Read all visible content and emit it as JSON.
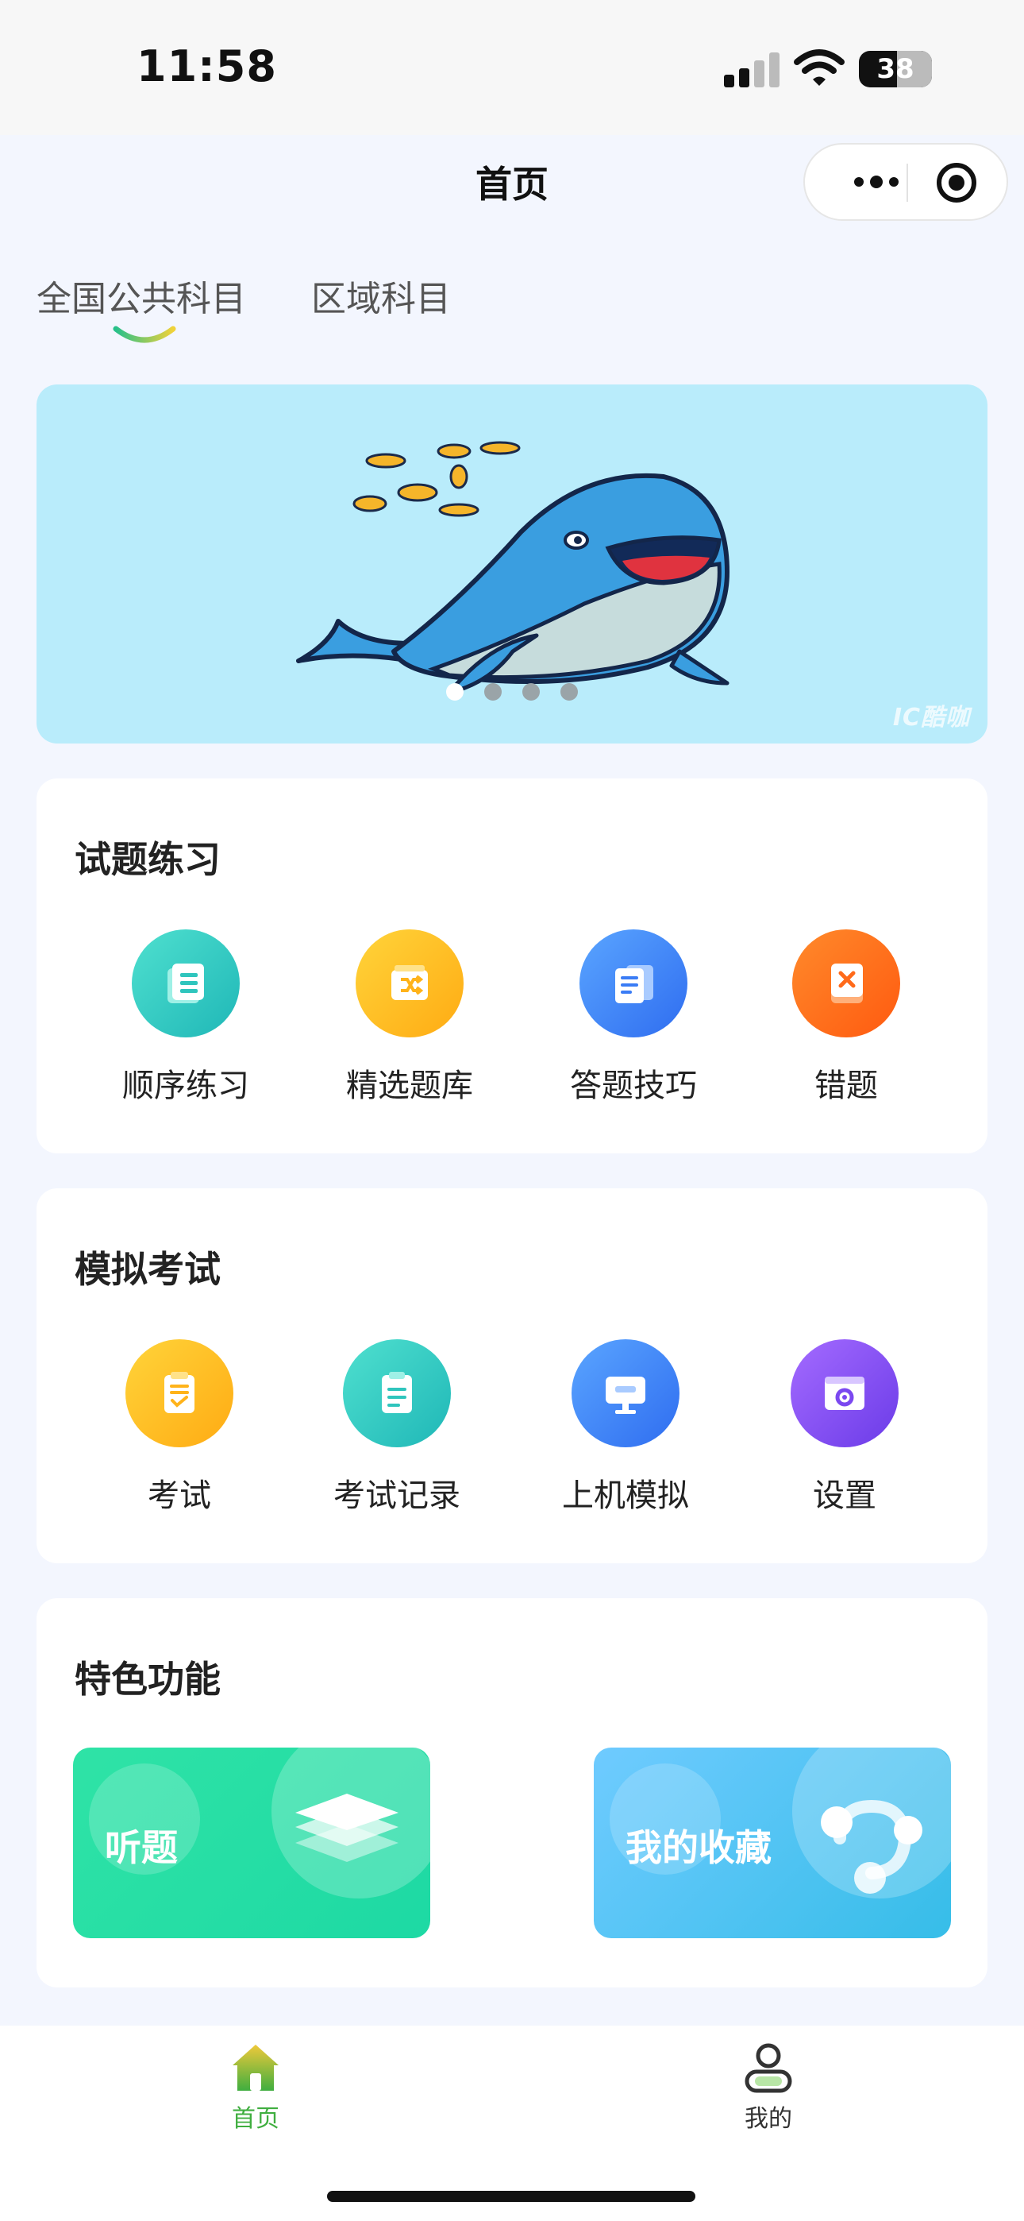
{
  "status_bar": {
    "time": "11:58",
    "battery": "38"
  },
  "nav": {
    "title": "首页",
    "more_icon": "more-dots-icon",
    "close_icon": "target-icon"
  },
  "tabs": [
    {
      "label": "全国公共科目",
      "active": true
    },
    {
      "label": "区域科目",
      "active": false
    }
  ],
  "banner": {
    "watermark": "IC酷咖",
    "page_count": 4,
    "current_page": 1
  },
  "practice": {
    "title": "试题练习",
    "items": [
      {
        "label": "顺序练习",
        "icon": "list-book-icon"
      },
      {
        "label": "精选题库",
        "icon": "shuffle-icon"
      },
      {
        "label": "答题技巧",
        "icon": "document-icon"
      },
      {
        "label": "错题",
        "icon": "wrong-book-icon"
      }
    ]
  },
  "exam": {
    "title": "模拟考试",
    "items": [
      {
        "label": "考试",
        "icon": "exam-paper-icon"
      },
      {
        "label": "考试记录",
        "icon": "clipboard-icon"
      },
      {
        "label": "上机模拟",
        "icon": "monitor-icon"
      },
      {
        "label": "设置",
        "icon": "settings-window-icon"
      }
    ]
  },
  "features": {
    "title": "特色功能",
    "items": [
      {
        "label": "听题",
        "icon": "layers-icon"
      },
      {
        "label": "我的收藏",
        "icon": "share-network-icon"
      }
    ]
  },
  "tabbar": {
    "items": [
      {
        "label": "首页",
        "active": true,
        "icon": "home-icon"
      },
      {
        "label": "我的",
        "active": false,
        "icon": "profile-icon"
      }
    ],
    "active_color": "#3fae3f",
    "inactive_color": "#333333"
  }
}
